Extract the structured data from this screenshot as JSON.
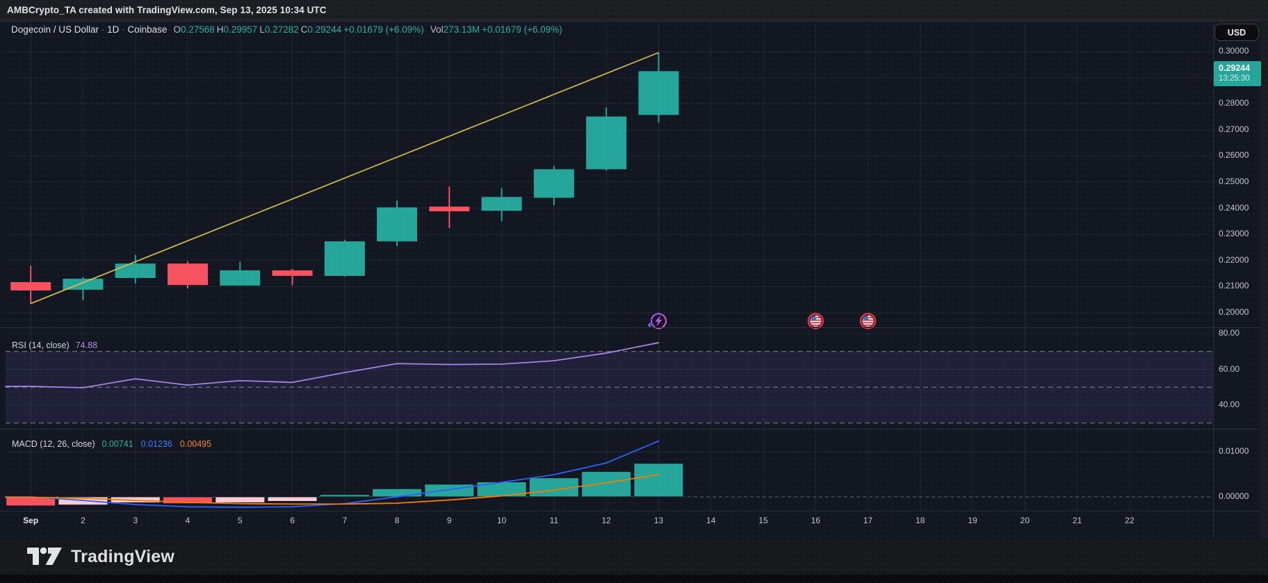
{
  "topbar": {
    "attribution": "AMBCrypto_TA created with TradingView.com, Sep 13, 2025 10:34 UTC"
  },
  "header": {
    "symbol": "Dogecoin / US Dollar",
    "separator": "·",
    "interval": "1D",
    "exchange": "Coinbase",
    "o_label": "O",
    "o": "0.27568",
    "h_label": "H",
    "h": "0.29957",
    "l_label": "L",
    "l": "0.27282",
    "c_label": "C",
    "c": "0.29244",
    "change": "+0.01679 (+6.09%)",
    "vol_label": "Vol",
    "vol": "273.13M",
    "vol_change": "+0.01679 (+6.09%)"
  },
  "rsi_legend": {
    "title": "RSI (14, close)",
    "value": "74.88"
  },
  "macd_legend": {
    "title": "MACD (12, 26, close)",
    "hist": "0.00741",
    "macd": "0.01236",
    "signal": "0.00495"
  },
  "axis": {
    "currency_button": "USD",
    "current_price": "0.29244",
    "countdown": "13:25:30",
    "price_ticks": [
      "0.30000",
      "0.28000",
      "0.27000",
      "0.26000",
      "0.25000",
      "0.24000",
      "0.23000",
      "0.22000",
      "0.21000",
      "0.20000"
    ],
    "rsi_ticks": [
      "80.00",
      "60.00",
      "40.00"
    ],
    "macd_ticks": [
      "0.01000",
      "0.00000"
    ],
    "time_labels": [
      "Sep",
      "2",
      "3",
      "4",
      "5",
      "6",
      "7",
      "8",
      "9",
      "10",
      "11",
      "12",
      "13",
      "14",
      "15",
      "16",
      "17",
      "18",
      "19",
      "20",
      "21",
      "22"
    ]
  },
  "footer": {
    "logo_text": "TradingView"
  },
  "colors": {
    "background": "#131722",
    "up": "#26a69a",
    "down": "#f7525f",
    "hist_pos": "#26a69a",
    "hist_neg_falling": "#f7525f",
    "hist_neg_rising": "#fbcdd2",
    "trendline": "#d9bd45",
    "rsi_line": "#a584e6",
    "rsi_band": "rgba(144,118,255,0.10)",
    "macd_line": "#2d62ff",
    "signal_line": "#f57c00",
    "grid": "rgba(160,175,210,0.10)",
    "separator": "#2b2f3a",
    "price_label_bg": "#26a69a",
    "event_ring_purple": "#b25ae0",
    "event_ring_red": "#e8353f"
  },
  "chart_data": [
    {
      "type": "candlestick",
      "title": "Dogecoin / US Dollar, 1D, Coinbase",
      "ylabel": "Price (USD)",
      "ylim": [
        0.2,
        0.3
      ],
      "grid": true,
      "dates": [
        "Sep 1",
        "Sep 2",
        "Sep 3",
        "Sep 4",
        "Sep 5",
        "Sep 6",
        "Sep 7",
        "Sep 8",
        "Sep 9",
        "Sep 10",
        "Sep 11",
        "Sep 12",
        "Sep 13"
      ],
      "ohlc_order": [
        "open",
        "high",
        "low",
        "close"
      ],
      "ohlc": [
        [
          0.2117,
          0.218,
          0.2035,
          0.2085
        ],
        [
          0.2088,
          0.2136,
          0.2048,
          0.213
        ],
        [
          0.2133,
          0.2221,
          0.2112,
          0.2188
        ],
        [
          0.2188,
          0.2196,
          0.2093,
          0.2106
        ],
        [
          0.2104,
          0.2194,
          0.2104,
          0.2162
        ],
        [
          0.2162,
          0.2168,
          0.2106,
          0.2141
        ],
        [
          0.2141,
          0.2279,
          0.2138,
          0.2273
        ],
        [
          0.2273,
          0.243,
          0.2255,
          0.2403
        ],
        [
          0.2406,
          0.2483,
          0.2324,
          0.2388
        ],
        [
          0.239,
          0.2477,
          0.235,
          0.2443
        ],
        [
          0.244,
          0.2562,
          0.2411,
          0.2549
        ],
        [
          0.2549,
          0.2785,
          0.2544,
          0.2751
        ],
        [
          0.27568,
          0.29957,
          0.27282,
          0.29244
        ]
      ],
      "trendline": {
        "from_date": "Sep 1",
        "from_price": 0.2035,
        "to_date": "Sep 13",
        "to_price": 0.29957
      },
      "events": [
        {
          "date": "Sep 13",
          "icon": "lightning-event-icon"
        },
        {
          "date": "Sep 16",
          "icon": "us-flag-event-icon"
        },
        {
          "date": "Sep 17",
          "icon": "us-flag-event-icon"
        }
      ]
    },
    {
      "type": "line",
      "name": "RSI (14, close)",
      "ylim": [
        27,
        83.5
      ],
      "levels": {
        "solid": [
          80,
          60,
          40
        ],
        "dashed": [
          70,
          50,
          30
        ],
        "band": [
          30,
          70
        ]
      },
      "dates": [
        "Sep 1",
        "Sep 2",
        "Sep 3",
        "Sep 4",
        "Sep 5",
        "Sep 6",
        "Sep 7",
        "Sep 8",
        "Sep 9",
        "Sep 10",
        "Sep 11",
        "Sep 12",
        "Sep 13"
      ],
      "values": [
        50.5,
        49.7,
        54.7,
        51.2,
        53.7,
        52.7,
        58.2,
        63.2,
        62.7,
        62.9,
        64.8,
        69.1,
        74.88
      ]
    },
    {
      "type": "bar",
      "name": "MACD (12, 26, close)",
      "yticks": [
        0.01,
        0.0
      ],
      "dates": [
        "Sep 1",
        "Sep 2",
        "Sep 3",
        "Sep 4",
        "Sep 5",
        "Sep 6",
        "Sep 7",
        "Sep 8",
        "Sep 9",
        "Sep 10",
        "Sep 11",
        "Sep 12",
        "Sep 13"
      ],
      "histogram": [
        -0.002,
        -0.0018,
        -0.0013,
        -0.0015,
        -0.0013,
        -0.001,
        0.0005,
        0.0018,
        0.0028,
        0.0033,
        0.0042,
        0.0056,
        0.00741
      ],
      "series": [
        {
          "name": "macd",
          "values": [
            0.0,
            -0.0008,
            -0.0017,
            -0.0022,
            -0.0023,
            -0.0022,
            -0.0015,
            0.0,
            0.0016,
            0.0032,
            0.0049,
            0.0075,
            0.01236
          ]
        },
        {
          "name": "signal",
          "values": [
            -0.0001,
            -0.0003,
            -0.0008,
            -0.0012,
            -0.0015,
            -0.0016,
            -0.0016,
            -0.0014,
            -0.0007,
            0.0002,
            0.0015,
            0.0031,
            0.00495
          ]
        }
      ]
    }
  ]
}
